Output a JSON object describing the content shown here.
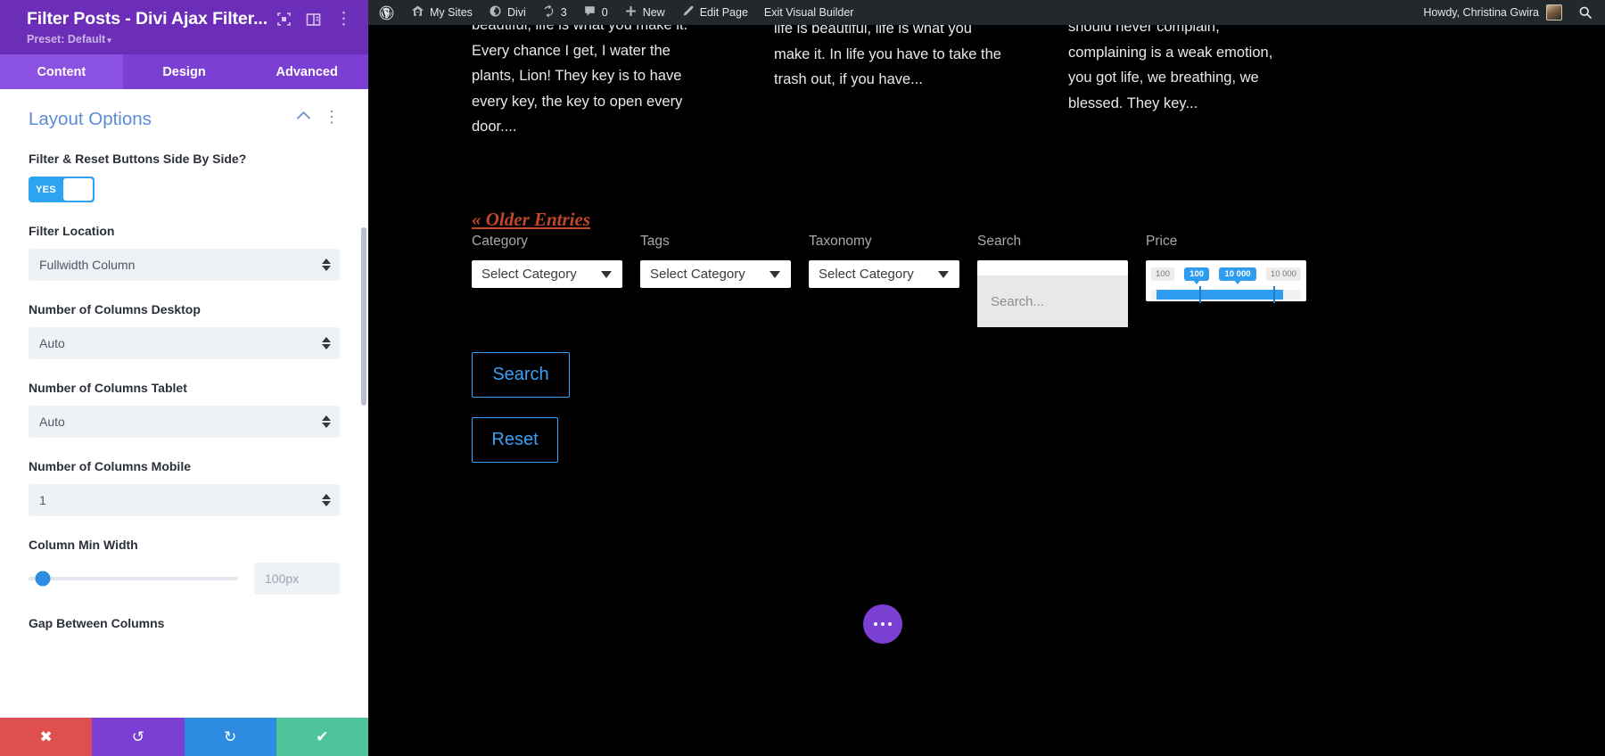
{
  "settings_panel": {
    "title": "Filter Posts - Divi Ajax Filter...",
    "preset_label": "Preset: Default",
    "preset_caret": "▾",
    "header_icons": [
      {
        "name": "focus-icon",
        "glyph": "⊡"
      },
      {
        "name": "layout-columns-icon",
        "glyph": "▥"
      },
      {
        "name": "more-vertical-icon",
        "glyph": "⋮"
      }
    ],
    "tabs": [
      {
        "label": "Content",
        "active": true
      },
      {
        "label": "Design",
        "active": false
      },
      {
        "label": "Advanced",
        "active": false
      }
    ],
    "section": {
      "title": "Layout Options",
      "collapse_icon": "⌃",
      "menu_icon": "⋮"
    },
    "fields": [
      {
        "name": "filter-reset-side-by-side",
        "label": "Filter & Reset Buttons Side By Side?",
        "type": "toggle",
        "value": "YES"
      },
      {
        "name": "filter-location",
        "label": "Filter Location",
        "type": "select",
        "value": "Fullwidth Column"
      },
      {
        "name": "columns-desktop",
        "label": "Number of Columns Desktop",
        "type": "select",
        "value": "Auto"
      },
      {
        "name": "columns-tablet",
        "label": "Number of Columns Tablet",
        "type": "select",
        "value": "Auto"
      },
      {
        "name": "columns-mobile",
        "label": "Number of Columns Mobile",
        "type": "select",
        "value": "1"
      },
      {
        "name": "column-min-width",
        "label": "Column Min Width",
        "type": "range",
        "value": "100px"
      },
      {
        "name": "gap-between-columns",
        "label": "Gap Between Columns",
        "type": "range",
        "value": ""
      }
    ],
    "footer_buttons": [
      {
        "name": "cancel-button",
        "glyph": "✖",
        "color": "#e04f4f"
      },
      {
        "name": "undo-button",
        "glyph": "↺",
        "color": "#7b3fd4"
      },
      {
        "name": "redo-button",
        "glyph": "↻",
        "color": "#2d8ce0"
      },
      {
        "name": "save-button",
        "glyph": "✔",
        "color": "#4fc49a"
      }
    ]
  },
  "admin_bar": {
    "logo_glyph": "Ⓦ",
    "items": [
      {
        "name": "my-sites",
        "icon": "sites-icon",
        "glyph": "⌂",
        "label": "My Sites"
      },
      {
        "name": "divi",
        "icon": "divi-icon",
        "glyph": "◕",
        "label": "Divi"
      },
      {
        "name": "updates",
        "icon": "updates-icon",
        "glyph": "⟳",
        "label": "3"
      },
      {
        "name": "comments",
        "icon": "comment-icon",
        "glyph": "🗨",
        "label": "0"
      },
      {
        "name": "new",
        "icon": "plus-icon",
        "glyph": "✚",
        "label": "New"
      },
      {
        "name": "edit-page",
        "icon": "pencil-icon",
        "glyph": "✎",
        "label": "Edit Page"
      },
      {
        "name": "exit-visual-builder",
        "icon": "",
        "glyph": "",
        "label": "Exit Visual Builder"
      }
    ],
    "howdy": "Howdy, Christina Gwira",
    "search_glyph": "🔍"
  },
  "preview": {
    "excerpts": [
      "beautiful, life is what you make it. Every chance I get, I water the plants, Lion! They key is to have every key, the key to open every door....",
      "life is beautiful, life is what you make it. In life you have to take the trash out, if you have...",
      "should never complain, complaining is a weak emotion, you got life, we breathing, we blessed. They key..."
    ],
    "pagination_link": "« Older Entries",
    "filters": [
      {
        "name": "category-filter",
        "label": "Category",
        "type": "dropdown",
        "value": "Select Category"
      },
      {
        "name": "tags-filter",
        "label": "Tags",
        "type": "dropdown",
        "value": "Select Category"
      },
      {
        "name": "taxonomy-filter",
        "label": "Taxonomy",
        "type": "dropdown",
        "value": "Select Category"
      },
      {
        "name": "search-filter",
        "label": "Search",
        "type": "text",
        "placeholder": "Search..."
      },
      {
        "name": "price-filter",
        "label": "Price",
        "type": "range"
      }
    ],
    "price": {
      "min_label": "100",
      "max_label": "10 000",
      "current_min": "100",
      "current_max": "10 000"
    },
    "buttons": [
      {
        "name": "search-button",
        "label": "Search"
      },
      {
        "name": "reset-button",
        "label": "Reset"
      }
    ],
    "accent_color": "#3aa0f5",
    "link_color": "#c0472a"
  }
}
